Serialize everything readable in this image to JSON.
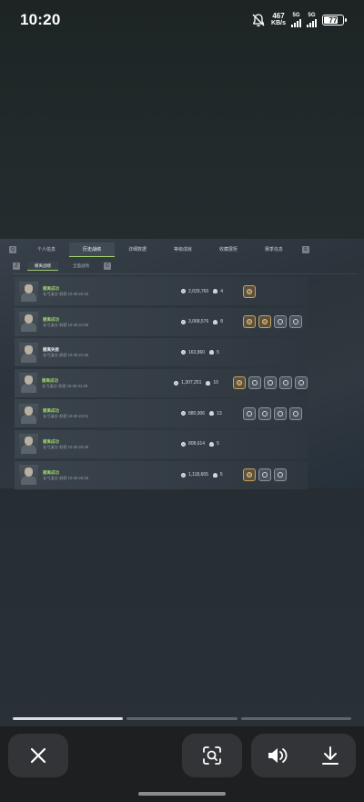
{
  "status_bar": {
    "time": "10:20",
    "net_speed": "467",
    "net_unit": "KB/s",
    "sim1": "5G",
    "sim2": "5G",
    "battery": "77"
  },
  "game": {
    "tabs": [
      "个人信息",
      "历史战绩",
      "详细数据",
      "等级成就",
      "收藏展柜",
      "赛季信息"
    ],
    "active_tab": 1,
    "subtabs": [
      "撤离战绩",
      "全面战场"
    ],
    "rows": [
      {
        "status": "撤离成功",
        "detail": "长弓溪谷·机密 10-30 22:10",
        "value": "2,029,760",
        "kills": "4",
        "badges": [
          "gold"
        ]
      },
      {
        "status": "撤离成功",
        "detail": "长弓溪谷·机密 10-30 21:56",
        "value": "3,068,576",
        "kills": "8",
        "badges": [
          "gold",
          "gold",
          "grey",
          "grey"
        ]
      },
      {
        "status": "撤离失败",
        "detail": "长弓溪谷·机密 10-30 21:46",
        "value": "163,860",
        "kills": "5",
        "badges": []
      },
      {
        "status": "撤离成功",
        "detail": "长弓溪谷·机密 10-30 21:29",
        "value": "1,307,251",
        "kills": "10",
        "badges": [
          "gold",
          "grey",
          "grey",
          "grey",
          "grey"
        ]
      },
      {
        "status": "撤离成功",
        "detail": "长弓溪谷·机密 10-30 21:01",
        "value": "880,906",
        "kills": "13",
        "badges": [
          "grey",
          "grey",
          "grey",
          "grey"
        ]
      },
      {
        "status": "撤离成功",
        "detail": "长弓溪谷·机密 10-30 20:49",
        "value": "808,614",
        "kills": "5",
        "badges": []
      },
      {
        "status": "撤离成功",
        "detail": "长弓溪谷·机密 10-30 20:25",
        "value": "1,118,665",
        "kills": "5",
        "badges": [
          "gold",
          "grey",
          "grey"
        ]
      }
    ]
  },
  "viewer": {
    "page_count": 3,
    "current_page": 1,
    "icons": {
      "close": "close-icon",
      "lens": "lens-search-icon",
      "volume": "volume-icon",
      "download": "download-icon"
    }
  }
}
